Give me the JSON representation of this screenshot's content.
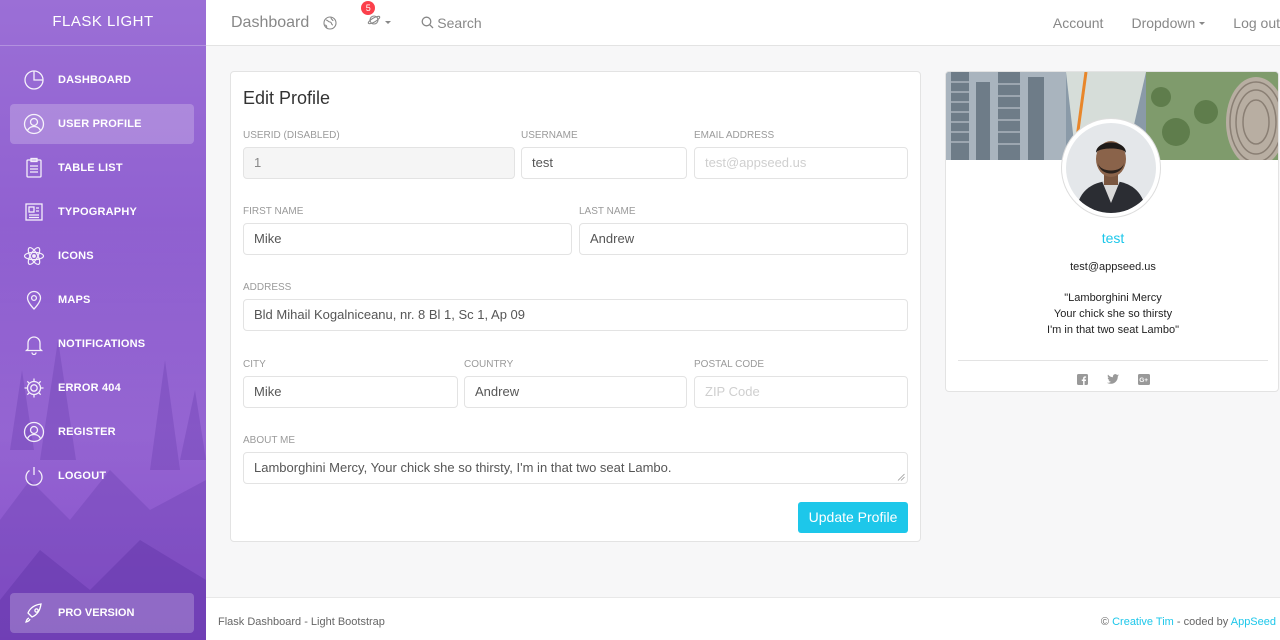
{
  "sidebar": {
    "brand": "FLASK LIGHT",
    "items": [
      {
        "label": "DASHBOARD",
        "icon": "chart-pie-icon"
      },
      {
        "label": "USER PROFILE",
        "icon": "user-circle-icon"
      },
      {
        "label": "TABLE LIST",
        "icon": "clipboard-icon"
      },
      {
        "label": "TYPOGRAPHY",
        "icon": "news-paper-icon"
      },
      {
        "label": "ICONS",
        "icon": "atom-icon"
      },
      {
        "label": "MAPS",
        "icon": "map-pin-icon"
      },
      {
        "label": "NOTIFICATIONS",
        "icon": "bell-icon"
      },
      {
        "label": "ERROR 404",
        "icon": "gear-icon"
      },
      {
        "label": "REGISTER",
        "icon": "user-circle-icon"
      },
      {
        "label": "LOGOUT",
        "icon": "power-icon"
      }
    ],
    "active_index": 1,
    "pro_label": "PRO VERSION"
  },
  "topbar": {
    "title": "Dashboard",
    "notifications_count": "5",
    "search_label": "Search",
    "account": "Account",
    "dropdown": "Dropdown",
    "logout": "Log out"
  },
  "edit_profile": {
    "heading": "Edit Profile",
    "userid_label": "USERID (DISABLED)",
    "userid_value": "1",
    "username_label": "USERNAME",
    "username_value": "test",
    "email_label": "EMAIL ADDRESS",
    "email_placeholder": "test@appseed.us",
    "first_name_label": "FIRST NAME",
    "first_name_value": "Mike",
    "last_name_label": "LAST NAME",
    "last_name_value": "Andrew",
    "address_label": "ADDRESS",
    "address_value": "Bld Mihail Kogalniceanu, nr. 8 Bl 1, Sc 1, Ap 09",
    "city_label": "CITY",
    "city_value": "Mike",
    "country_label": "COUNTRY",
    "country_value": "Andrew",
    "postal_label": "POSTAL CODE",
    "postal_placeholder": "ZIP Code",
    "about_label": "ABOUT ME",
    "about_value": "Lamborghini Mercy, Your chick she so thirsty, I'm in that two seat Lambo.",
    "submit_label": "Update Profile"
  },
  "user_card": {
    "name": "test",
    "email": "test@appseed.us",
    "quote_line1": "\"Lamborghini Mercy",
    "quote_line2": "Your chick she so thirsty",
    "quote_line3": "I'm in that two seat Lambo\"",
    "social_icons": [
      "facebook-icon",
      "twitter-icon",
      "google-plus-icon"
    ]
  },
  "footer": {
    "left": "Flask Dashboard - Light Bootstrap",
    "copyright": "©",
    "creative_tim": "Creative Tim",
    "coded_by": "- coded by",
    "appseed": "AppSeed"
  },
  "colors": {
    "accent": "#1dc7ea",
    "sidebar_top": "#9b6fd6",
    "sidebar_bottom": "#8247c9",
    "badge": "#fb404b"
  }
}
